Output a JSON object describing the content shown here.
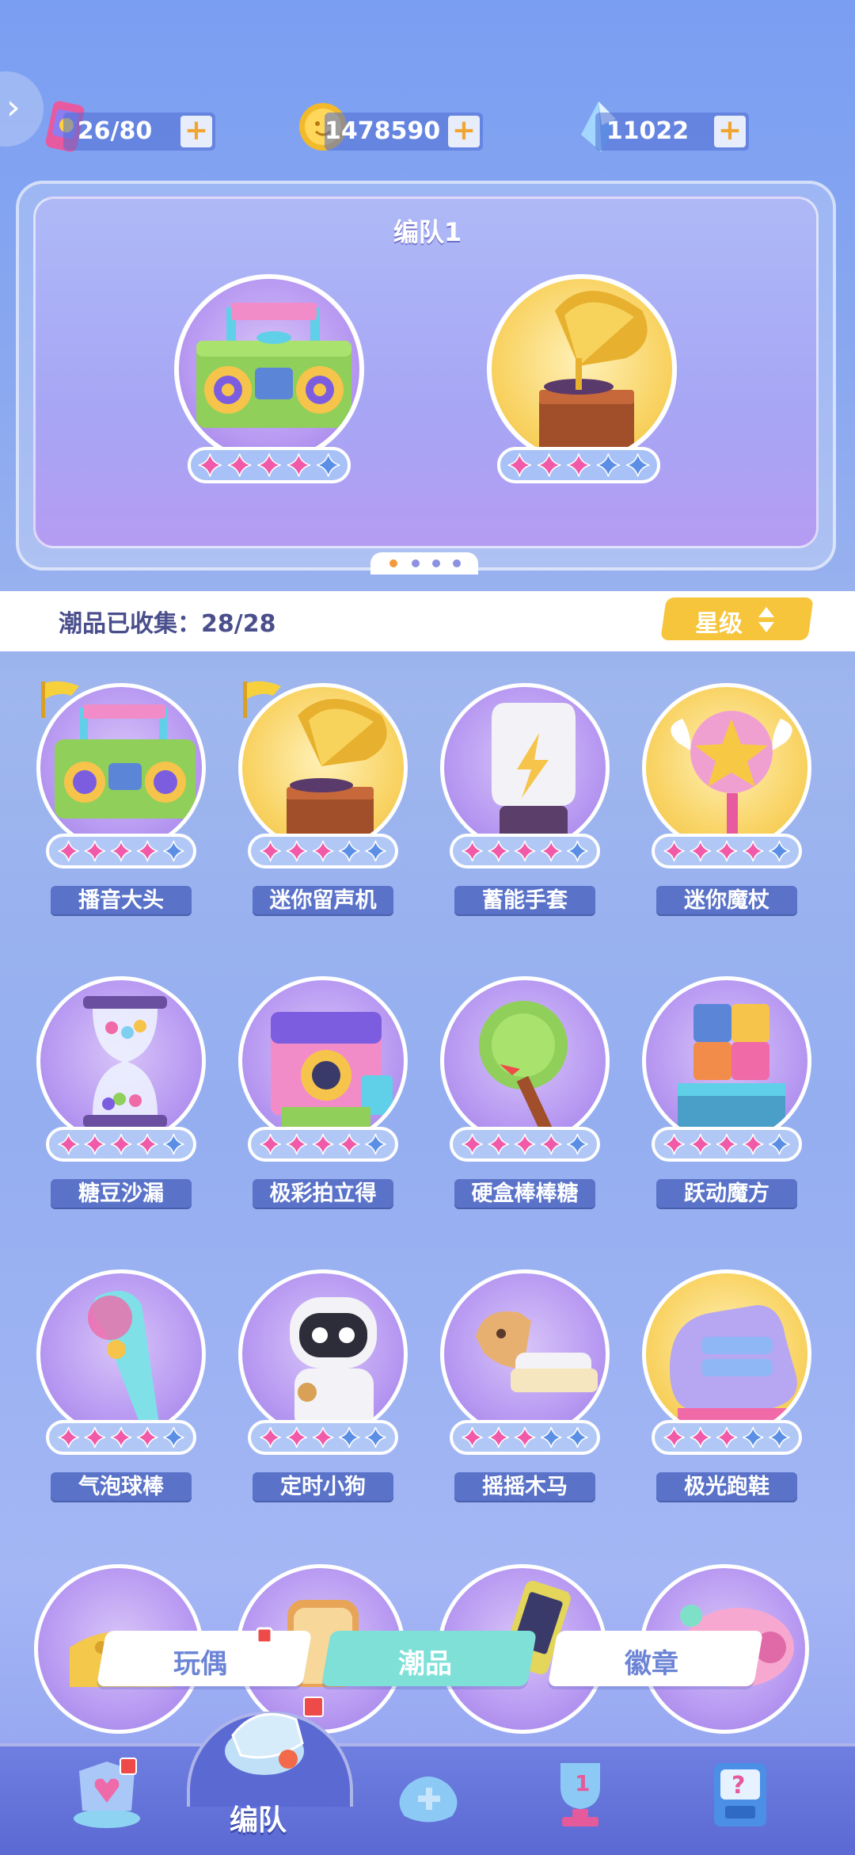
{
  "currencies": [
    {
      "icon": "energy-can-icon",
      "value": "26/80",
      "plus": "+"
    },
    {
      "icon": "gold-coin-icon",
      "value": "1478590",
      "plus": "+"
    },
    {
      "icon": "crystal-gem-icon",
      "value": "11022",
      "plus": "+"
    }
  ],
  "team": {
    "title": "编队1",
    "slots": [
      {
        "item": "boombox",
        "stars_filled": 4,
        "stars_total": 5
      },
      {
        "item": "gramophone",
        "stars_filled": 3,
        "stars_total": 5
      }
    ],
    "pages": 4,
    "current_page": 1
  },
  "collection": {
    "label": "潮品已收集：28/28",
    "sort_button": "星级"
  },
  "items": [
    {
      "name": "播音大头",
      "bg": "purple",
      "stars": 4,
      "flag": true,
      "icon": "boombox-icon"
    },
    {
      "name": "迷你留声机",
      "bg": "gold",
      "stars": 3,
      "flag": true,
      "icon": "gramophone-icon"
    },
    {
      "name": "蓄能手套",
      "bg": "purple",
      "stars": 4,
      "flag": false,
      "icon": "lightning-glove-icon"
    },
    {
      "name": "迷你魔杖",
      "bg": "gold",
      "stars": 4,
      "flag": false,
      "icon": "star-wand-icon"
    },
    {
      "name": "糖豆沙漏",
      "bg": "purple",
      "stars": 4,
      "flag": false,
      "icon": "candy-hourglass-icon"
    },
    {
      "name": "极彩拍立得",
      "bg": "purple",
      "stars": 4,
      "flag": false,
      "icon": "instant-camera-icon"
    },
    {
      "name": "硬盒棒棒糖",
      "bg": "purple",
      "stars": 4,
      "flag": false,
      "icon": "lollipop-icon"
    },
    {
      "name": "跃动魔方",
      "bg": "purple",
      "stars": 4,
      "flag": false,
      "icon": "rubik-box-icon"
    },
    {
      "name": "气泡球棒",
      "bg": "purple",
      "stars": 4,
      "flag": false,
      "icon": "bubble-bat-icon"
    },
    {
      "name": "定时小狗",
      "bg": "purple",
      "stars": 3,
      "flag": false,
      "icon": "robot-dog-icon"
    },
    {
      "name": "摇摇木马",
      "bg": "purple",
      "stars": 3,
      "flag": false,
      "icon": "rocking-horse-icon"
    },
    {
      "name": "极光跑鞋",
      "bg": "gold",
      "stars": 3,
      "flag": false,
      "icon": "aurora-sneaker-icon"
    }
  ],
  "partial_items": [
    {
      "icon": "cheese-icon",
      "bg": "purple"
    },
    {
      "icon": "bread-icon",
      "bg": "purple"
    },
    {
      "icon": "phone-device-icon",
      "bg": "purple"
    },
    {
      "icon": "pink-speaker-icon",
      "bg": "purple"
    }
  ],
  "tabs": [
    {
      "label": "玩偶",
      "active": false
    },
    {
      "label": "潮品",
      "active": true
    },
    {
      "label": "徽章",
      "active": false
    }
  ],
  "nav": {
    "active_label": "编队",
    "items": [
      "heart-shield-icon",
      "whistle-icon",
      "gamepad-icon",
      "trophy-icon",
      "gift-machine-icon"
    ]
  },
  "colors": {
    "star_pink": "#f05aa8",
    "star_blue": "#5b8fe6",
    "accent_gold": "#f7c53b",
    "tab_active": "#7fe0d8"
  }
}
